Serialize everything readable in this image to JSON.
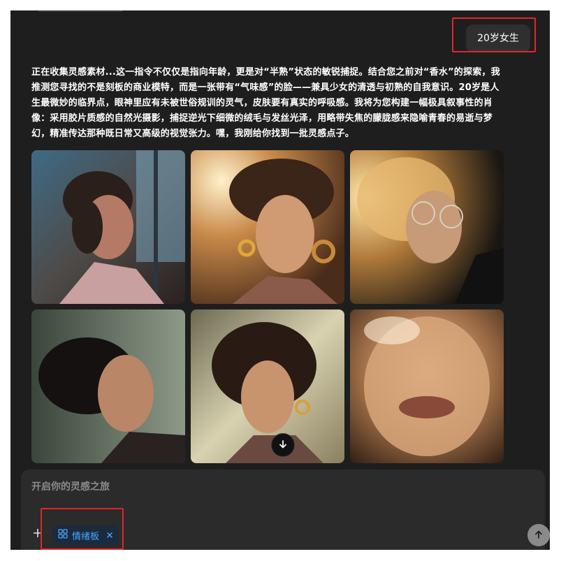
{
  "conversation": {
    "user_message": "20岁女生",
    "assistant_message": "正在收集灵感素材...这一指令不仅仅是指向年龄，更是对“半熟”状态的敏锐捕捉。结合您之前对“香水”的探索，我推测您寻找的不是刻板的商业模特，而是一张带有“气味感”的脸——兼具少女的清透与初熟的自我意识。20岁是人生最微妙的临界点，眼神里应有未被世俗规训的灵气，皮肤要有真实的呼吸感。我将为您构建一幅极具叙事性的肖像：采用胶片质感的自然光摄影，捕捉逆光下细微的绒毛与发丝光泽，用略带失焦的朦胧感来隐喻青春的易逝与梦幻，精准传达那种既日常又高级的视觉张力。嘿，我刚给你找到一批灵感点子。",
    "image_grid": {
      "rows": 2,
      "columns": 3,
      "images": [
        {
          "description": "woman with curly hair in window light"
        },
        {
          "description": "curly hair portrait with gold hoop earring, warm backlight"
        },
        {
          "description": "woman with round glasses in golden backlight"
        },
        {
          "description": "woman with closed eyes, dark hair, green background"
        },
        {
          "description": "curly hair portrait with hoop earrings"
        },
        {
          "description": "close-up face in soft glowing light"
        }
      ]
    }
  },
  "composer": {
    "placeholder": "开启你的灵感之旅",
    "chip_label": "情绪板"
  },
  "icons": {
    "scroll_down": "arrow-down-icon",
    "plus": "plus-icon",
    "chip": "grid-icon",
    "chip_close": "close-icon",
    "send": "arrow-up-icon"
  },
  "colors": {
    "background": "#1e1e1e",
    "composer": "#2b2b2b",
    "accent": "#4aa6ff",
    "highlight": "#e4252b"
  }
}
